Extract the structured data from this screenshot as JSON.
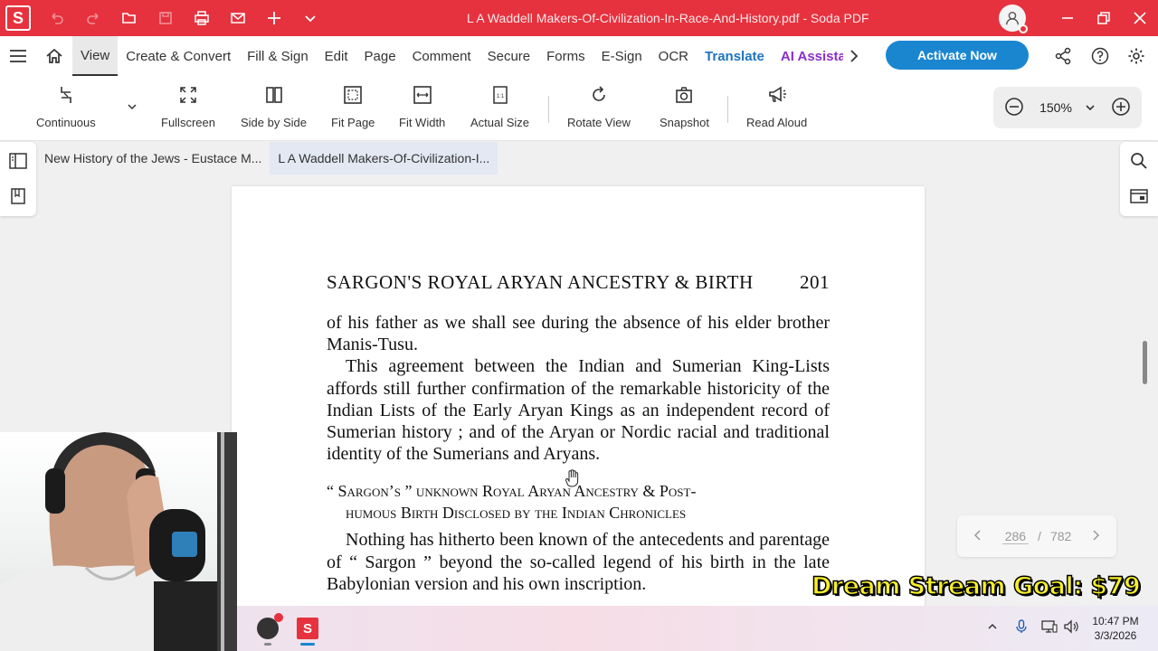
{
  "titlebar": {
    "logo": "S",
    "title": "L A Waddell Makers-Of-Civilization-In-Race-And-History.pdf  -  Soda PDF",
    "icons": [
      "undo-icon",
      "redo-icon",
      "open-folder-icon",
      "save-icon",
      "print-icon",
      "mail-icon",
      "add-icon",
      "chevron-down-icon"
    ]
  },
  "menu": {
    "items": [
      "View",
      "Create & Convert",
      "Fill & Sign",
      "Edit",
      "Page",
      "Comment",
      "Secure",
      "Forms",
      "E-Sign",
      "OCR"
    ],
    "translate": "Translate",
    "ai": "AI Assistant",
    "activate": "Activate Now"
  },
  "toolbar": {
    "continuous": "Continuous",
    "fullscreen": "Fullscreen",
    "side_by_side": "Side by Side",
    "fit_page": "Fit Page",
    "fit_width": "Fit Width",
    "actual_size": "Actual Size",
    "rotate_view": "Rotate View",
    "snapshot": "Snapshot",
    "read_aloud": "Read Aloud",
    "zoom": "150%"
  },
  "tabs": [
    "New History of the Jews - Eustace M...",
    "L A Waddell Makers-Of-Civilization-I..."
  ],
  "page": {
    "running_head": "SARGON'S ROYAL ARYAN ANCESTRY & BIRTH",
    "page_number": "201",
    "para1": "of his father as we shall see during the absence of his elder brother Manis-Tusu.",
    "para2": "This agreement between the Indian and Sumerian King-Lists affords still further confirmation of the remarkable historicity of the Indian Lists of the Early Aryan Kings as an independent record of Sumerian history ; and of the Aryan or Nordic racial and traditional identity of the Sumerians and Aryans.",
    "section_line1": "“ Sargon’s ” unknown Royal Aryan Ancestry & Post-",
    "section_line2": "humous Birth Disclosed by the Indian Chronicles",
    "para3": "Nothing has hitherto been known of the antecedents and parentage of “ Sargon ” beyond the so-called legend of his birth in the late Babylonian version and his own inscription."
  },
  "pagenav": {
    "current": "286",
    "separator": "/",
    "total": "782"
  },
  "overlay": {
    "goal": "Dream Stream Goal: $79"
  },
  "taskbar": {
    "time": "10:47 PM",
    "date": "3/3/2026",
    "soda_label": "S"
  },
  "colors": {
    "brand_red": "#e5323e",
    "activate_blue": "#1a86d0",
    "translate_blue": "#1e73be",
    "ai_purple": "#8b2fc9",
    "goal_yellow": "#f6ef2a"
  }
}
